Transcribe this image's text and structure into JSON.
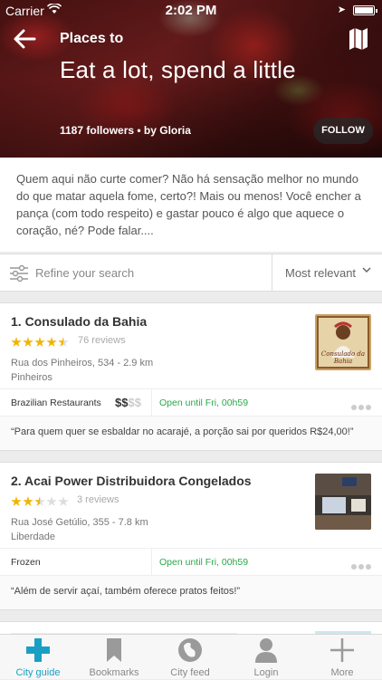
{
  "status_bar": {
    "carrier": "Carrier",
    "time": "2:02 PM"
  },
  "header": {
    "subtitle": "Places to",
    "title": "Eat a lot, spend a little",
    "meta": "1187 followers • by Gloria",
    "follow_label": "FOLLOW"
  },
  "description": "Quem aqui não curte comer? Não há sensação melhor no mundo do que matar aquela fome, certo?! Mais ou menos! Você encher a pança (com todo respeito) e gastar pouco é algo que aquece o coração, né? Pode falar....",
  "search": {
    "placeholder": "Refine your search",
    "sort_label": "Most relevant"
  },
  "places": [
    {
      "name": "1. Consulado da Bahia",
      "rating": 4.5,
      "reviews": "76 reviews",
      "address": "Rua dos Pinheiros, 534 - 2.9 km",
      "neighborhood": "Pinheiros",
      "category": "Brazilian Restaurants",
      "price_active": "$$",
      "price_inactive": "$$",
      "hours": "Open until Fri, 00h59",
      "quote": "“Para quem quer se esbaldar no acarajé, a porção sai por queridos R$24,00!”",
      "thumb_label": "Consulado da Bahia"
    },
    {
      "name": "2. Acai Power Distribuidora Congelados",
      "rating": 2.5,
      "reviews": "3 reviews",
      "address": "Rua José Getúlio, 355 - 7.8 km",
      "neighborhood": "Liberdade",
      "category": "Frozen",
      "hours": "Open until Fri, 00h59",
      "quote": "“Além de servir açaí, também oferece pratos feitos!”"
    }
  ],
  "tabs": [
    {
      "label": "City guide",
      "icon": "city-guide-icon",
      "active": true
    },
    {
      "label": "Bookmarks",
      "icon": "bookmark-icon",
      "active": false
    },
    {
      "label": "City feed",
      "icon": "city-feed-icon",
      "active": false
    },
    {
      "label": "Login",
      "icon": "user-icon",
      "active": false
    },
    {
      "label": "More",
      "icon": "plus-icon",
      "active": false
    }
  ],
  "colors": {
    "accent": "#1a9fc4",
    "open_green": "#2aa84a",
    "star": "#f0b400"
  }
}
